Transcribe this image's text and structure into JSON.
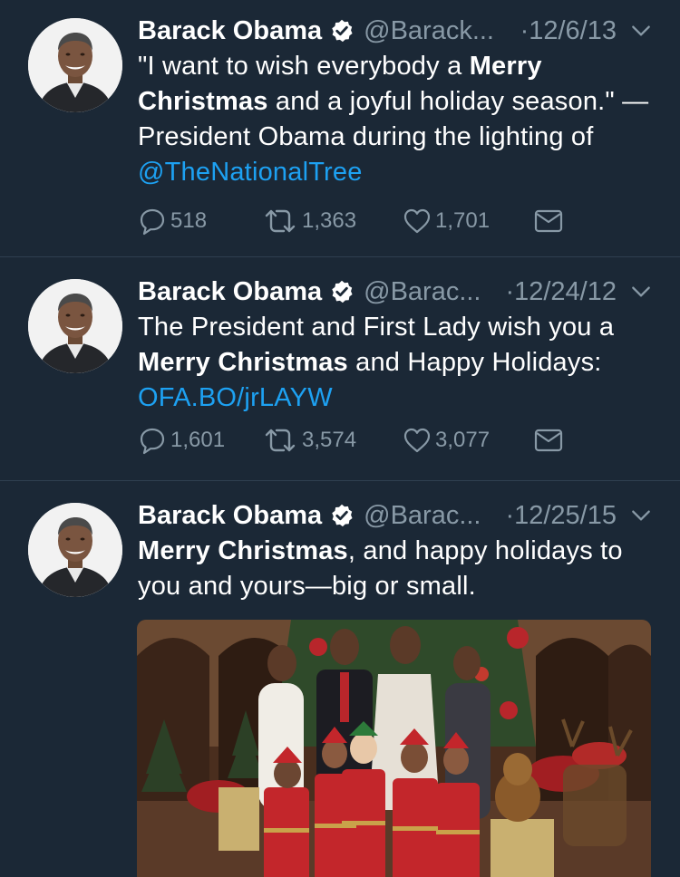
{
  "tweets": [
    {
      "name": "Barack Obama",
      "handle": "@Barack...",
      "date": "·12/6/13",
      "text": {
        "p1": "\"I want to wish everybody a ",
        "b1": "Merry Christmas",
        "p2": " and a joyful holiday season.\" —President Obama during the lighting of ",
        "link": "@TheNationalTree"
      },
      "replies": "518",
      "retweets": "1,363",
      "likes": "1,701"
    },
    {
      "name": "Barack Obama",
      "handle": "@Barac...",
      "date": "·12/24/12",
      "text": {
        "p1": "The President and First Lady wish you a ",
        "b1": "Merry Christmas",
        "p2": " and Happy Holidays: ",
        "link": "OFA.BO/jrLAYW"
      },
      "replies": "1,601",
      "retweets": "3,574",
      "likes": "3,077"
    },
    {
      "name": "Barack Obama",
      "handle": "@Barac...",
      "date": "·12/25/15",
      "text": {
        "b1": "Merry Christmas",
        "p1": ", and happy holidays to you and yours—big or small."
      }
    }
  ],
  "colors": {
    "background": "#1b2836",
    "secondary_text": "#8899a6",
    "link": "#1da1f2",
    "divider": "#2f3f50"
  },
  "icons": [
    "verified-badge-icon",
    "chevron-down-icon",
    "reply-icon",
    "retweet-icon",
    "like-icon",
    "direct-message-icon"
  ]
}
